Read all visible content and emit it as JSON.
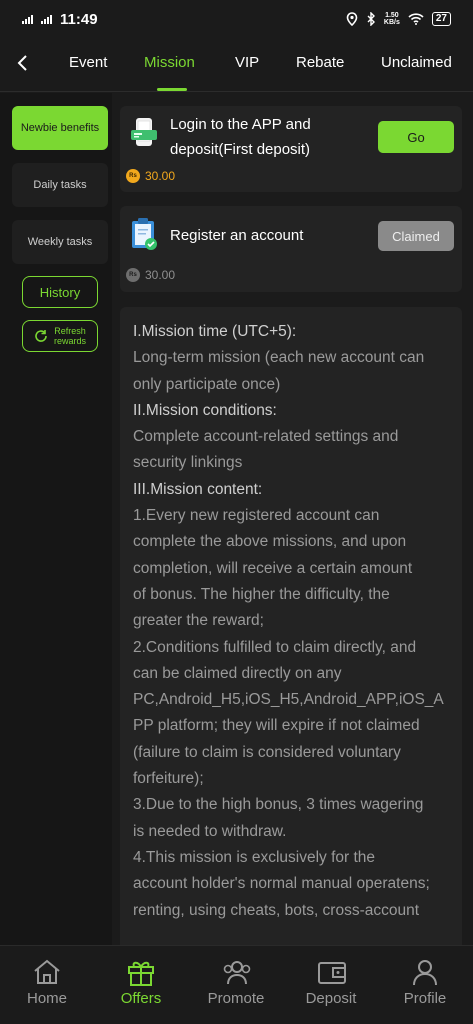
{
  "status_bar": {
    "time": "11:49",
    "net_speed_value": "1.50",
    "net_speed_unit": "KB/s",
    "battery": "27"
  },
  "tabs": [
    {
      "label": "Event"
    },
    {
      "label": "Mission"
    },
    {
      "label": "VIP"
    },
    {
      "label": "Rebate"
    },
    {
      "label": "Unclaimed"
    }
  ],
  "active_tab": "Mission",
  "sidebar": {
    "items": [
      {
        "label": "Newbie benefits"
      },
      {
        "label": "Daily tasks"
      },
      {
        "label": "Weekly tasks"
      }
    ],
    "history_label": "History",
    "refresh_line1": "Refresh",
    "refresh_line2": "rewards"
  },
  "missions": [
    {
      "title_line1": "Login to the APP and",
      "title_line2": "deposit(First deposit)",
      "reward": "30.00",
      "button": "Go",
      "coin_label": "Rs",
      "icon": "phone-deposit-icon"
    },
    {
      "title_line1": "Register an account",
      "reward": "30.00",
      "button": "Claimed",
      "coin_label": "Rs",
      "icon": "clipboard-check-icon"
    }
  ],
  "rules": {
    "h1": "I.Mission time (UTC+5):",
    "p1a": "Long-term mission (each new account can",
    "p1b": "only participate once)",
    "h2": "II.Mission conditions:",
    "p2a": "Complete account-related settings and",
    "p2b": "security linkings",
    "h3": "III.Mission content:",
    "c1a": "1.Every new registered account can",
    "c1b": "complete the above missions, and upon",
    "c1c": "completion, will receive a certain amount",
    "c1d": "of bonus. The higher the difficulty, the",
    "c1e": "greater the reward;",
    "c2a": "2.Conditions fulfilled to claim directly, and",
    "c2b": "can be claimed directly on any",
    "c2c": "PC,Android_H5,iOS_H5,Android_APP,iOS_A",
    "c2d": "PP platform; they will expire if not claimed",
    "c2e": "(failure to claim is considered voluntary",
    "c2f": "forfeiture);",
    "c3a": "3.Due to the high bonus, 3 times wagering",
    "c3b": "is needed to withdraw.",
    "c4a": "4.This mission is exclusively for the",
    "c4b": "account holder's normal manual operatens;",
    "c4c": "renting, using cheats, bots, cross-account"
  },
  "bottom_nav": [
    {
      "label": "Home",
      "icon": "home-icon"
    },
    {
      "label": "Offers",
      "icon": "gift-icon"
    },
    {
      "label": "Promote",
      "icon": "group-icon"
    },
    {
      "label": "Deposit",
      "icon": "wallet-icon"
    },
    {
      "label": "Profile",
      "icon": "profile-icon"
    }
  ],
  "colors": {
    "accent": "#7bd832",
    "background": "#1b1b1b",
    "card": "#232323",
    "coin_gold": "#f2a81d",
    "claimed_gray": "#8a8a8a"
  }
}
